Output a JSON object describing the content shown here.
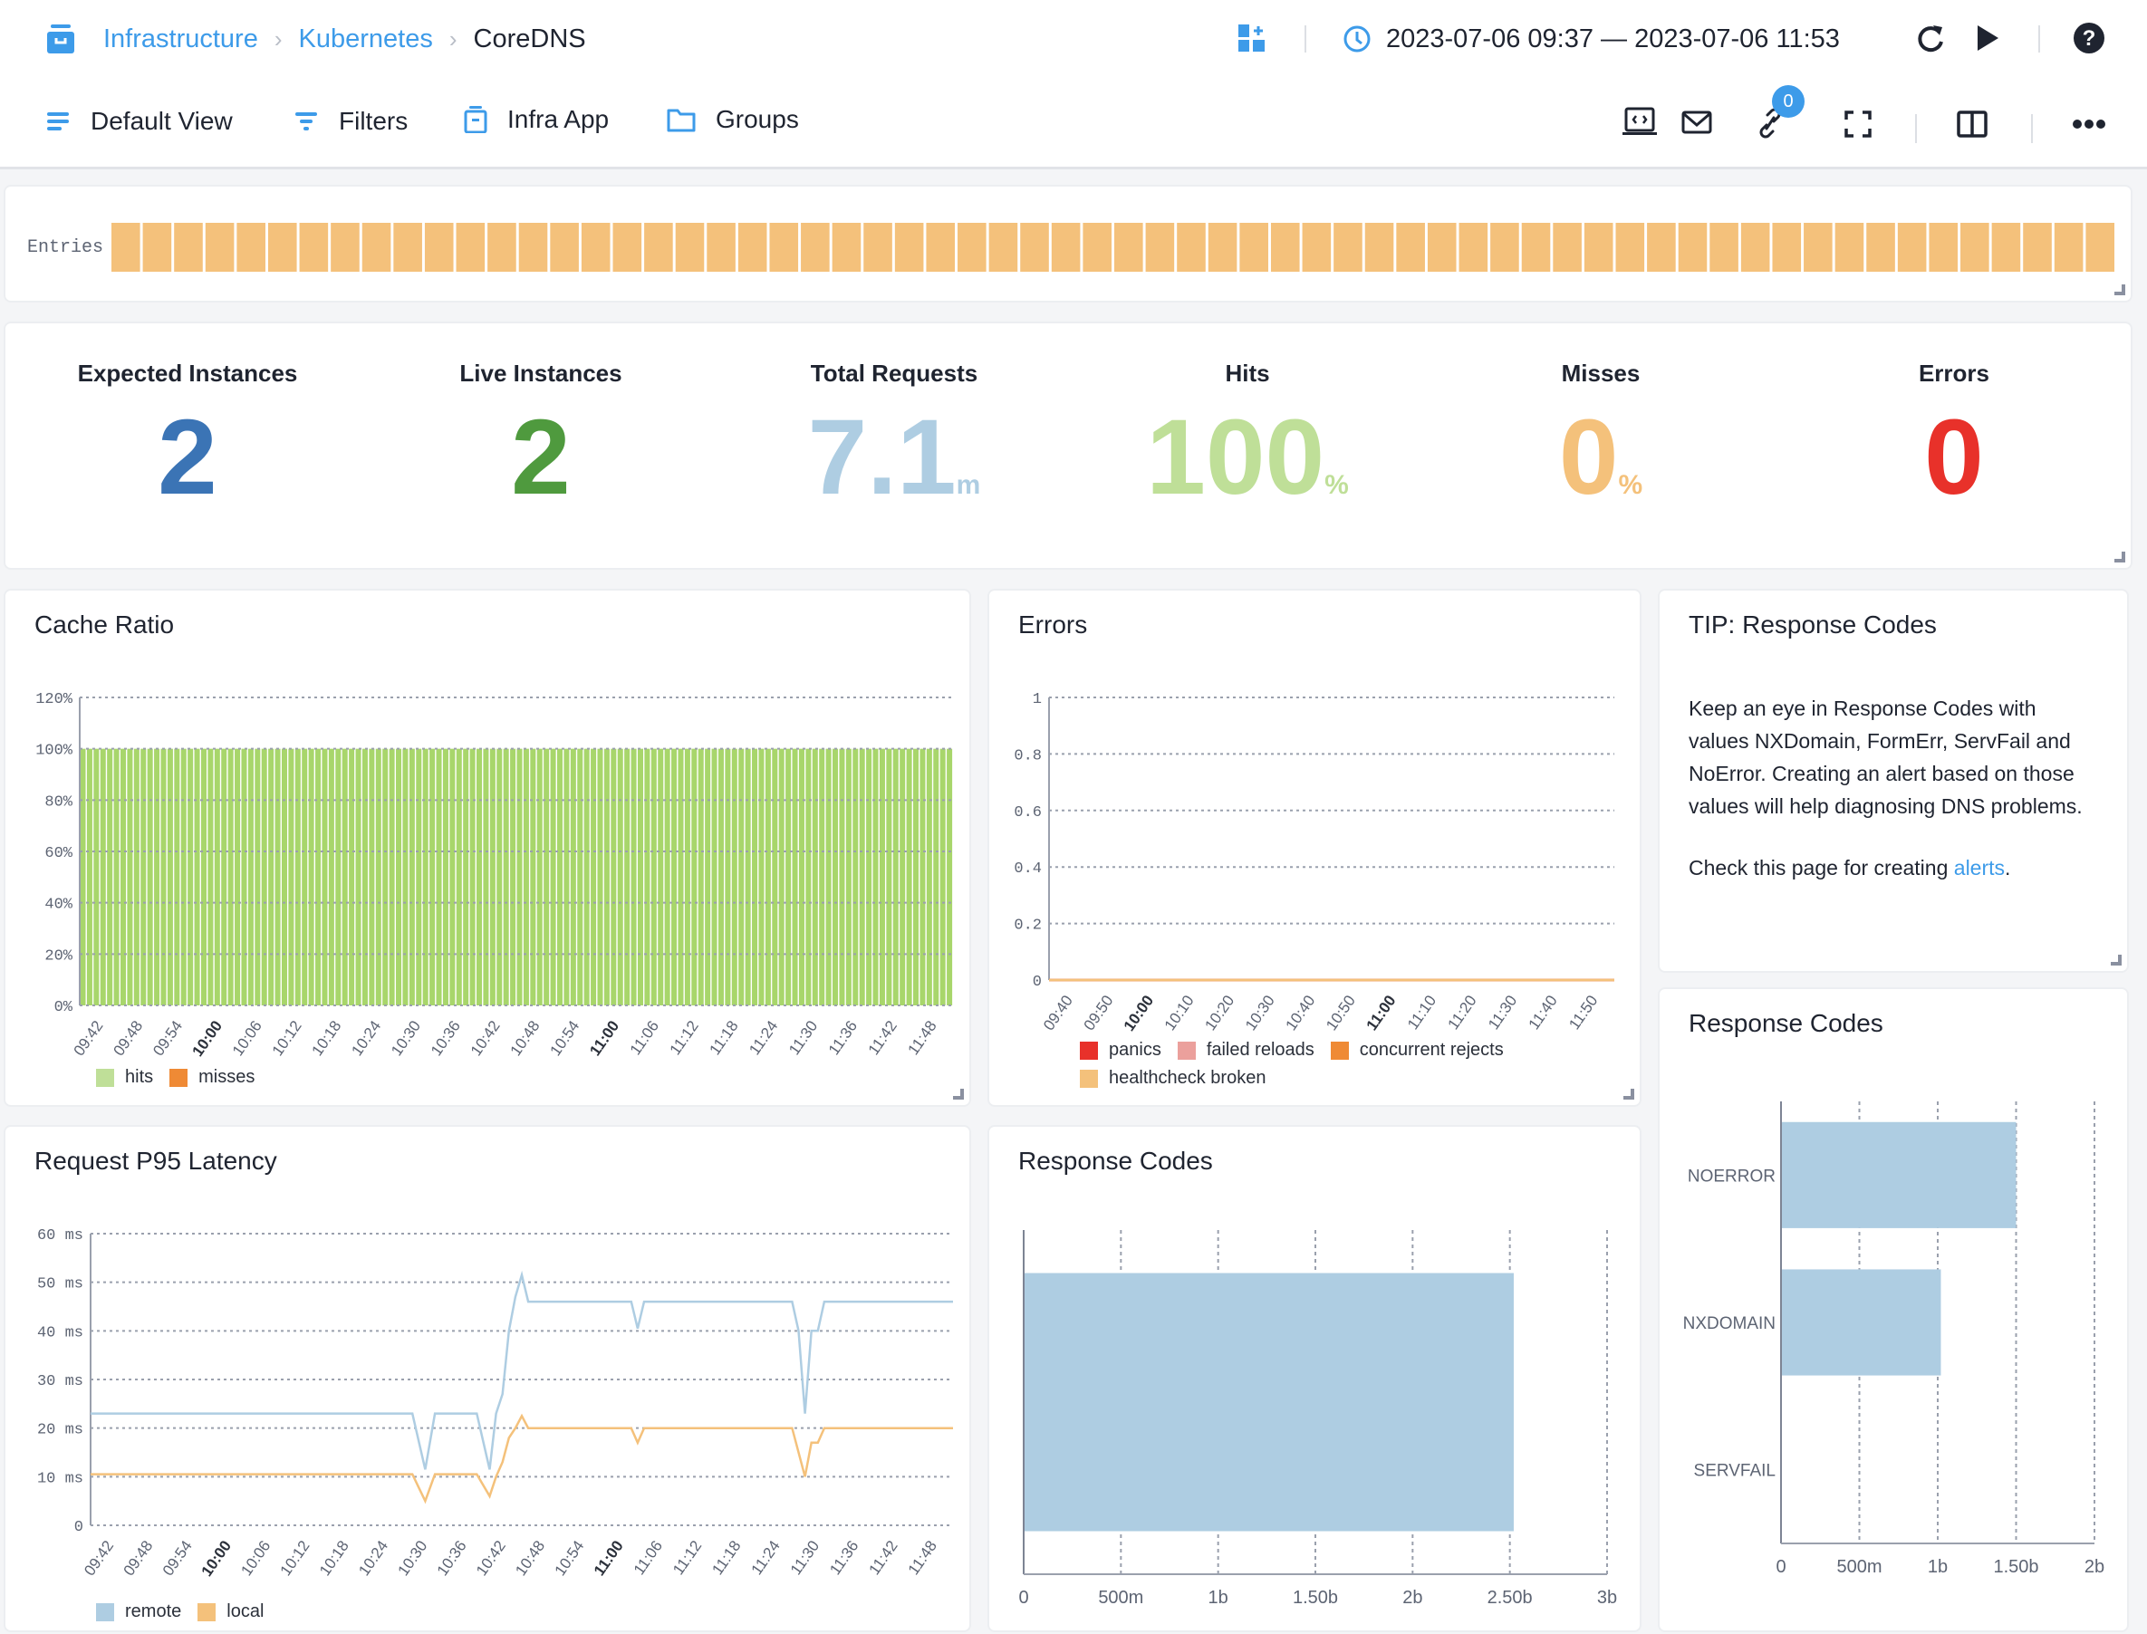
{
  "header": {
    "breadcrumb": [
      "Infrastructure",
      "Kubernetes",
      "CoreDNS"
    ],
    "time_range": "2023-07-06 09:37 — 2023-07-06 11:53",
    "icons": [
      "add-widget-icon",
      "clock-icon",
      "refresh-icon",
      "play-icon",
      "help-icon"
    ]
  },
  "toolbar": {
    "default_view": "Default View",
    "filters": "Filters",
    "infra_app": "Infra App",
    "groups": "Groups",
    "link_badge_count": "0",
    "icons": [
      "embed-icon",
      "mail-icon",
      "link-icon",
      "fullscreen-icon",
      "split-view-icon",
      "more-icon"
    ]
  },
  "entries": {
    "label": "Entries",
    "bar_count": 64,
    "color": "#f4c17b"
  },
  "kpis": [
    {
      "label": "Expected Instances",
      "value": "2",
      "unit": "",
      "color": "#3b74b5"
    },
    {
      "label": "Live Instances",
      "value": "2",
      "unit": "",
      "color": "#4f9a3e"
    },
    {
      "label": "Total Requests",
      "value": "7.1",
      "unit": "m",
      "color": "#aecde2"
    },
    {
      "label": "Hits",
      "value": "100",
      "unit": "%",
      "color": "#bfdf98"
    },
    {
      "label": "Misses",
      "value": "0",
      "unit": "%",
      "color": "#f4c17b"
    },
    {
      "label": "Errors",
      "value": "0",
      "unit": "",
      "color": "#e8312a"
    }
  ],
  "tip": {
    "title": "TIP: Response Codes",
    "paragraph1": "Keep an eye in Response Codes with values NXDomain, FormErr, ServFail and NoError. Creating an alert based on those values will help diagnosing DNS problems.",
    "paragraph2_prefix": "Check this page for creating ",
    "paragraph2_link": "alerts",
    "paragraph2_suffix": "."
  },
  "chart_data": [
    {
      "id": "cache-ratio",
      "type": "bar",
      "title": "Cache Ratio",
      "stacked": true,
      "x_ticks": [
        "09:42",
        "09:48",
        "09:54",
        "10:00",
        "10:06",
        "10:12",
        "10:18",
        "10:24",
        "10:30",
        "10:36",
        "10:42",
        "10:48",
        "10:54",
        "11:00",
        "11:06",
        "11:12",
        "11:18",
        "11:24",
        "11:30",
        "11:36",
        "11:42",
        "11:48"
      ],
      "bold_ticks": [
        "10:00",
        "11:00"
      ],
      "y_ticks": [
        "0%",
        "20%",
        "40%",
        "60%",
        "80%",
        "100%",
        "120%"
      ],
      "ylim": [
        0,
        120
      ],
      "bar_count": 130,
      "series": [
        {
          "name": "hits",
          "color": "#bfdf98",
          "value": 100
        },
        {
          "name": "misses",
          "color": "#ef8a35",
          "value": 0
        }
      ],
      "grid": true,
      "legend": "bottom-left"
    },
    {
      "id": "errors",
      "type": "line",
      "title": "Errors",
      "x_ticks": [
        "09:40",
        "09:50",
        "10:00",
        "10:10",
        "10:20",
        "10:30",
        "10:40",
        "10:50",
        "11:00",
        "11:10",
        "11:20",
        "11:30",
        "11:40",
        "11:50"
      ],
      "bold_ticks": [
        "10:00",
        "11:00"
      ],
      "y_ticks": [
        "0",
        "0.2",
        "0.4",
        "0.6",
        "0.8",
        "1"
      ],
      "ylim": [
        0,
        1
      ],
      "series": [
        {
          "name": "panics",
          "color": "#e8312a",
          "value": 0
        },
        {
          "name": "failed reloads",
          "color": "#eba09c",
          "value": 0
        },
        {
          "name": "concurrent rejects",
          "color": "#ef8a35",
          "value": 0
        },
        {
          "name": "healthcheck broken",
          "color": "#f4c17b",
          "value": 0
        }
      ],
      "grid": true,
      "legend": "bottom-left"
    },
    {
      "id": "latency",
      "type": "line",
      "title": "Request P95 Latency",
      "x_ticks": [
        "09:42",
        "09:48",
        "09:54",
        "10:00",
        "10:06",
        "10:12",
        "10:18",
        "10:24",
        "10:30",
        "10:36",
        "10:42",
        "10:48",
        "10:54",
        "11:00",
        "11:06",
        "11:12",
        "11:18",
        "11:24",
        "11:30",
        "11:36",
        "11:42",
        "11:48"
      ],
      "bold_ticks": [
        "10:00",
        "11:00"
      ],
      "y_ticks": [
        "0",
        "10 ms",
        "20 ms",
        "30 ms",
        "40 ms",
        "50 ms",
        "60 ms"
      ],
      "ylim": [
        0,
        60
      ],
      "x_minutes_range": [
        0,
        134
      ],
      "series": [
        {
          "name": "remote",
          "color": "#aecde2",
          "points": [
            [
              0,
              23
            ],
            [
              50,
              23
            ],
            [
              52,
              11.5
            ],
            [
              53.5,
              23
            ],
            [
              60,
              23
            ],
            [
              62,
              11.5
            ],
            [
              63,
              23
            ],
            [
              64,
              27
            ],
            [
              65,
              40
            ],
            [
              66,
              47
            ],
            [
              67,
              51.5
            ],
            [
              68,
              46
            ],
            [
              84,
              46
            ],
            [
              85,
              40.5
            ],
            [
              86,
              46
            ],
            [
              109,
              46
            ],
            [
              110,
              40
            ],
            [
              111,
              23
            ],
            [
              112,
              40
            ],
            [
              113,
              40
            ],
            [
              114,
              46
            ],
            [
              134,
              46
            ]
          ]
        },
        {
          "name": "local",
          "color": "#f4c17b",
          "points": [
            [
              0,
              10.5
            ],
            [
              50,
              10.5
            ],
            [
              52,
              5
            ],
            [
              53.5,
              10.5
            ],
            [
              60,
              10.5
            ],
            [
              62,
              6
            ],
            [
              63,
              10
            ],
            [
              64,
              13
            ],
            [
              65,
              18
            ],
            [
              66,
              20
            ],
            [
              67,
              22.5
            ],
            [
              68,
              20
            ],
            [
              84,
              20
            ],
            [
              85,
              17
            ],
            [
              86,
              20
            ],
            [
              109,
              20
            ],
            [
              111,
              10
            ],
            [
              112,
              17
            ],
            [
              113,
              17
            ],
            [
              114,
              20
            ],
            [
              134,
              20
            ]
          ]
        }
      ],
      "grid": true,
      "legend": "bottom-left"
    },
    {
      "id": "response-codes-total",
      "type": "bar",
      "orientation": "horizontal",
      "title": "Response Codes",
      "categories": [
        ""
      ],
      "values": [
        2520000000
      ],
      "x_ticks": [
        "0",
        "500m",
        "1b",
        "1.50b",
        "2b",
        "2.50b",
        "3b"
      ],
      "xlim": [
        0,
        3000000000
      ],
      "color": "#aecde2",
      "grid": true
    },
    {
      "id": "response-codes-by-type",
      "type": "bar",
      "orientation": "horizontal",
      "title": "Response Codes",
      "categories": [
        "NOERROR",
        "NXDOMAIN",
        "SERVFAIL"
      ],
      "values": [
        1500000000,
        1020000000,
        0
      ],
      "x_ticks": [
        "0",
        "500m",
        "1b",
        "1.50b",
        "2b"
      ],
      "xlim": [
        0,
        2000000000
      ],
      "color": "#aecde2",
      "grid": true
    }
  ]
}
